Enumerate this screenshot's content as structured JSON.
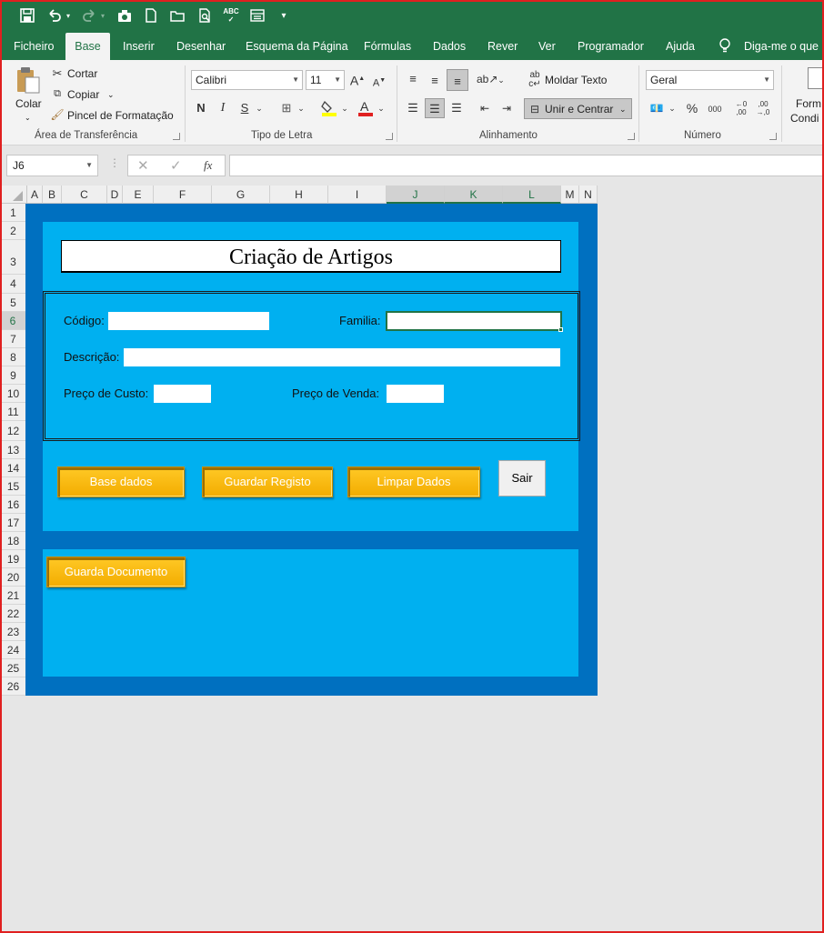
{
  "quick_access": {
    "icons": [
      "save-icon",
      "undo-icon",
      "redo-icon",
      "camera-icon",
      "new-file-icon",
      "open-folder-icon",
      "print-preview-icon",
      "spelling-icon",
      "form-icon",
      "customize-icon"
    ]
  },
  "tabs": [
    "Ficheiro",
    "Base",
    "Inserir",
    "Desenhar",
    "Esquema da Página",
    "Fórmulas",
    "Dados",
    "Rever",
    "Ver",
    "Programador",
    "Ajuda",
    "Diga-me o que p"
  ],
  "ribbon": {
    "clipboard": {
      "paste": "Colar",
      "cut": "Cortar",
      "copy": "Copiar",
      "format_painter": "Pincel de Formatação",
      "label": "Área de Transferência"
    },
    "font": {
      "name": "Calibri",
      "size": "11",
      "bold": "N",
      "italic": "I",
      "underline": "S",
      "label": "Tipo de Letra"
    },
    "alignment": {
      "wrap": "Moldar Texto",
      "merge": "Unir e Centrar",
      "label": "Alinhamento"
    },
    "number": {
      "format": "Geral",
      "label": "Número"
    },
    "styles": {
      "cond_format_line1": "Form",
      "cond_format_line2": "Condi"
    }
  },
  "formula_bar": {
    "name_box": "J6",
    "fx": "fx",
    "value": ""
  },
  "columns": [
    "A",
    "B",
    "C",
    "D",
    "E",
    "F",
    "G",
    "H",
    "I",
    "J",
    "K",
    "L",
    "M",
    "N"
  ],
  "rows": [
    "1",
    "2",
    "3",
    "4",
    "5",
    "6",
    "7",
    "8",
    "9",
    "10",
    "11",
    "12",
    "13",
    "14",
    "15",
    "16",
    "17",
    "18",
    "19",
    "20",
    "21",
    "22",
    "23",
    "24",
    "25",
    "26"
  ],
  "form": {
    "title": "Criação de Artigos",
    "codigo_label": "Código:",
    "familia_label": "Familia:",
    "descricao_label": "Descrição:",
    "preco_custo_label": "Preço de Custo:",
    "preco_venda_label": "Preço de Venda:",
    "buttons": {
      "base_dados": "Base dados",
      "guardar_registo": "Guardar Registo",
      "limpar_dados": "Limpar Dados",
      "sair": "Sair",
      "guarda_documento": "Guarda Documento"
    }
  },
  "colors": {
    "excel_green": "#217346",
    "frame_blue": "#0070c0",
    "panel_cyan": "#00b0f0",
    "button_gold": "#ffc000",
    "window_border": "#e02020"
  }
}
